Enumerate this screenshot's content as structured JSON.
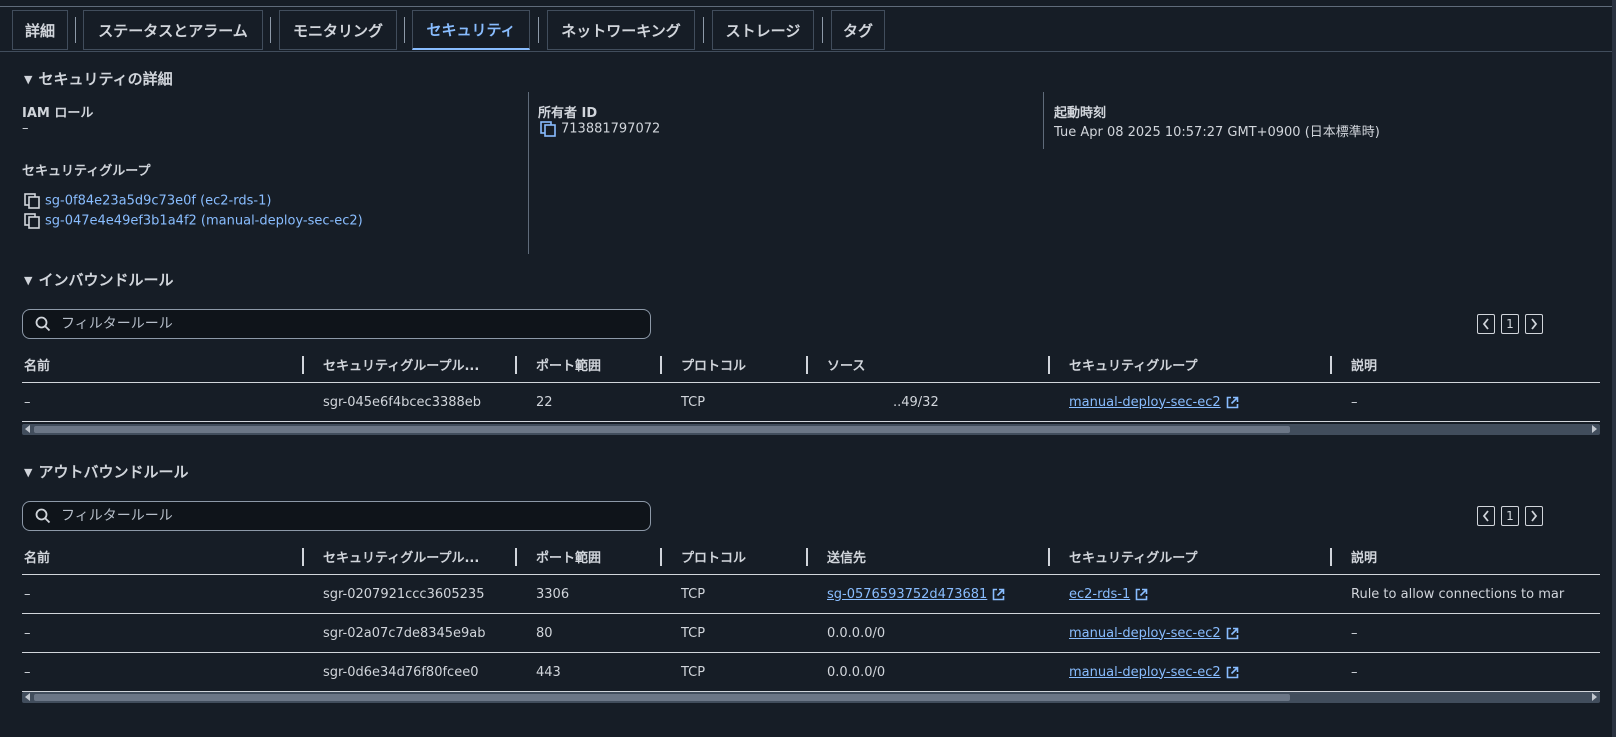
{
  "tabs": [
    "詳細",
    "ステータスとアラーム",
    "モニタリング",
    "セキュリティ",
    "ネットワーキング",
    "ストレージ",
    "タグ"
  ],
  "active_tab": "セキュリティ",
  "security_details": {
    "title": "セキュリティの詳細",
    "iam_role_label": "IAM ロール",
    "iam_role_value": "–",
    "owner_id_label": "所有者 ID",
    "owner_id_value": "713881797072",
    "launch_time_label": "起動時刻",
    "launch_time_value": "Tue Apr 08 2025 10:57:27 GMT+0900 (日本標準時)",
    "security_groups_label": "セキュリティグループ",
    "security_groups": [
      "sg-0f84e23a5d9c73e0f (ec2-rds-1)",
      "sg-047e4e49ef3b1a4f2 (manual-deploy-sec-ec2)"
    ]
  },
  "inbound": {
    "title": "インバウンドルール",
    "search_placeholder": "フィルタールール",
    "page": "1",
    "columns": [
      "名前",
      "セキュリティグループル...",
      "ポート範囲",
      "プロトコル",
      "ソース",
      "セキュリティグループ",
      "説明"
    ],
    "rows": [
      {
        "name": "–",
        "rule_id": "sgr-045e6f4bcec3388eb",
        "port": "22",
        "protocol": "TCP",
        "source": "..49/32",
        "sg": "manual-deploy-sec-ec2",
        "desc": "–"
      }
    ]
  },
  "outbound": {
    "title": "アウトバウンドルール",
    "search_placeholder": "フィルタールール",
    "page": "1",
    "columns": [
      "名前",
      "セキュリティグループル...",
      "ポート範囲",
      "プロトコル",
      "送信先",
      "セキュリティグループ",
      "説明"
    ],
    "rows": [
      {
        "name": "–",
        "rule_id": "sgr-0207921ccc3605235",
        "port": "3306",
        "protocol": "TCP",
        "dest": "sg-0576593752d473681",
        "sg": "ec2-rds-1",
        "desc": "Rule to allow connections to mar"
      },
      {
        "name": "–",
        "rule_id": "sgr-02a07c7de8345e9ab",
        "port": "80",
        "protocol": "TCP",
        "dest": "0.0.0.0/0",
        "sg": "manual-deploy-sec-ec2",
        "desc": "–"
      },
      {
        "name": "–",
        "rule_id": "sgr-0d6e34d76f80fcee0",
        "port": "443",
        "protocol": "TCP",
        "dest": "0.0.0.0/0",
        "sg": "manual-deploy-sec-ec2",
        "desc": "–"
      }
    ]
  },
  "colors": {
    "link": "#89bdff",
    "background": "#161d26",
    "text": "#d1d5db"
  }
}
